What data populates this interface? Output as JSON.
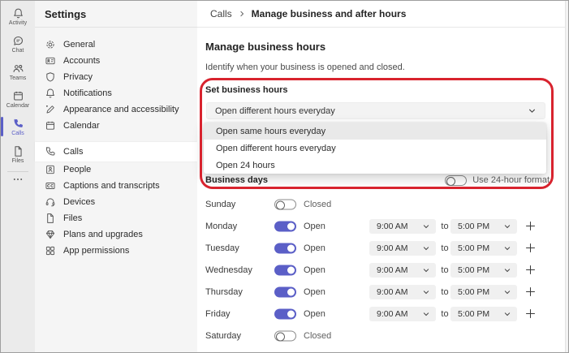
{
  "colors": {
    "accent": "#5b5fc7",
    "callout_red": "#d8232e"
  },
  "rail": {
    "items": [
      {
        "label": "Activity",
        "icon": "bell-icon",
        "selected": false
      },
      {
        "label": "Chat",
        "icon": "chat-icon",
        "selected": false
      },
      {
        "label": "Teams",
        "icon": "teams-icon",
        "selected": false
      },
      {
        "label": "Calendar",
        "icon": "calendar-icon",
        "selected": false
      },
      {
        "label": "Calls",
        "icon": "phone-icon",
        "selected": true
      },
      {
        "label": "Files",
        "icon": "file-icon",
        "selected": false
      }
    ],
    "more_icon": "more-icon"
  },
  "sidebar": {
    "title": "Settings",
    "items": [
      {
        "label": "General",
        "icon": "gear-icon",
        "selected": false
      },
      {
        "label": "Accounts",
        "icon": "id-card-icon",
        "selected": false
      },
      {
        "label": "Privacy",
        "icon": "shield-icon",
        "selected": false
      },
      {
        "label": "Notifications",
        "icon": "bell-icon",
        "selected": false
      },
      {
        "label": "Appearance and accessibility",
        "icon": "pen-icon",
        "selected": false
      },
      {
        "label": "Calendar",
        "icon": "calendar-icon",
        "selected": false
      },
      {
        "label": "Calls",
        "icon": "phone-icon",
        "selected": true
      },
      {
        "label": "People",
        "icon": "person-card-icon",
        "selected": false
      },
      {
        "label": "Captions and transcripts",
        "icon": "cc-icon",
        "selected": false
      },
      {
        "label": "Devices",
        "icon": "headset-icon",
        "selected": false
      },
      {
        "label": "Files",
        "icon": "file-icon",
        "selected": false
      },
      {
        "label": "Plans and upgrades",
        "icon": "gem-icon",
        "selected": false
      },
      {
        "label": "App permissions",
        "icon": "grid-icon",
        "selected": false
      }
    ]
  },
  "header": {
    "breadcrumb_section": "Calls",
    "breadcrumb_page": "Manage business and after hours"
  },
  "main": {
    "heading": "Manage business hours",
    "description": "Identify when your business is opened and closed.",
    "set_business_hours": {
      "label": "Set business hours",
      "selected": "Open different hours everyday",
      "options": [
        "Open same hours everyday",
        "Open different hours everyday",
        "Open 24 hours"
      ],
      "highlighted_option_index": 0
    },
    "business_days": {
      "label": "Business days",
      "format_label": "Use 24-hour format",
      "format_toggle_on": false
    },
    "to_separator": "to",
    "days": [
      {
        "name": "Sunday",
        "open": false,
        "state_label": "Closed"
      },
      {
        "name": "Monday",
        "open": true,
        "state_label": "Open",
        "start": "9:00 AM",
        "end": "5:00 PM"
      },
      {
        "name": "Tuesday",
        "open": true,
        "state_label": "Open",
        "start": "9:00 AM",
        "end": "5:00 PM"
      },
      {
        "name": "Wednesday",
        "open": true,
        "state_label": "Open",
        "start": "9:00 AM",
        "end": "5:00 PM"
      },
      {
        "name": "Thursday",
        "open": true,
        "state_label": "Open",
        "start": "9:00 AM",
        "end": "5:00 PM"
      },
      {
        "name": "Friday",
        "open": true,
        "state_label": "Open",
        "start": "9:00 AM",
        "end": "5:00 PM"
      },
      {
        "name": "Saturday",
        "open": false,
        "state_label": "Closed"
      }
    ]
  }
}
